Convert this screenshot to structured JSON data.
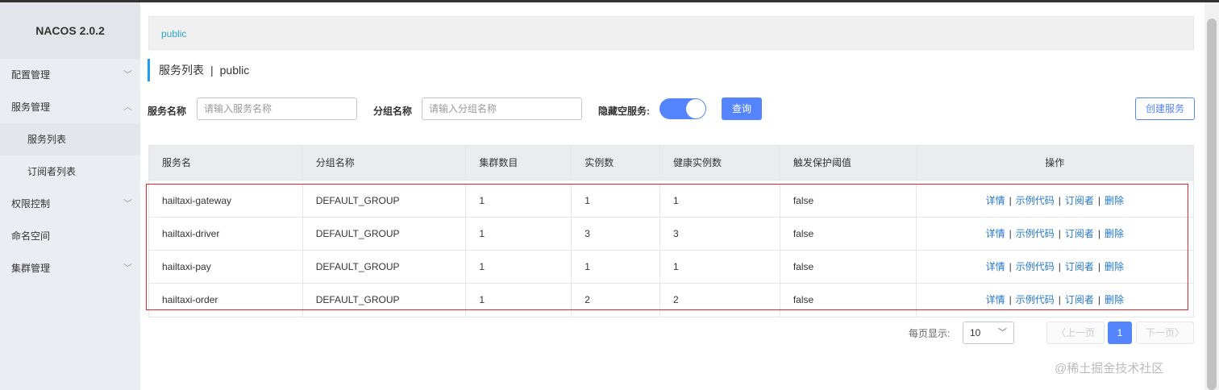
{
  "brand": "NACOS 2.0.2",
  "sidebar": {
    "items": [
      {
        "label": "配置管理"
      },
      {
        "label": "服务管理"
      },
      {
        "label": "服务列表"
      },
      {
        "label": "订阅者列表"
      },
      {
        "label": "权限控制"
      },
      {
        "label": "命名空间"
      },
      {
        "label": "集群管理"
      }
    ]
  },
  "breadcrumb": "public",
  "page": {
    "title": "服务列表",
    "sep": "|",
    "namespace": "public"
  },
  "filters": {
    "service_label": "服务名称",
    "service_placeholder": "请输入服务名称",
    "group_label": "分组名称",
    "group_placeholder": "请输入分组名称",
    "hide_empty_label": "隐藏空服务:",
    "hide_empty_on": true,
    "query_button": "查询",
    "create_button": "创建服务"
  },
  "table": {
    "headers": [
      "服务名",
      "分组名称",
      "集群数目",
      "实例数",
      "健康实例数",
      "触发保护阈值",
      "操作"
    ],
    "rows": [
      {
        "name": "hailtaxi-gateway",
        "group": "DEFAULT_GROUP",
        "clusters": "1",
        "instances": "1",
        "healthy": "1",
        "threshold": "false"
      },
      {
        "name": "hailtaxi-driver",
        "group": "DEFAULT_GROUP",
        "clusters": "1",
        "instances": "3",
        "healthy": "3",
        "threshold": "false"
      },
      {
        "name": "hailtaxi-pay",
        "group": "DEFAULT_GROUP",
        "clusters": "1",
        "instances": "1",
        "healthy": "1",
        "threshold": "false"
      },
      {
        "name": "hailtaxi-order",
        "group": "DEFAULT_GROUP",
        "clusters": "1",
        "instances": "2",
        "healthy": "2",
        "threshold": "false"
      }
    ],
    "actions": {
      "detail": "详情",
      "sample": "示例代码",
      "subscriber": "订阅者",
      "delete": "删除",
      "sep": "|"
    }
  },
  "pager": {
    "label": "每页显示:",
    "page_size": "10",
    "prev": "上一页",
    "current": "1",
    "next": "下一页"
  },
  "watermark": "@稀土掘金技术社区",
  "colors": {
    "primary": "#5584ff",
    "link": "#2277d3",
    "highlight": "#e3262e",
    "accent": "#209bfa"
  }
}
